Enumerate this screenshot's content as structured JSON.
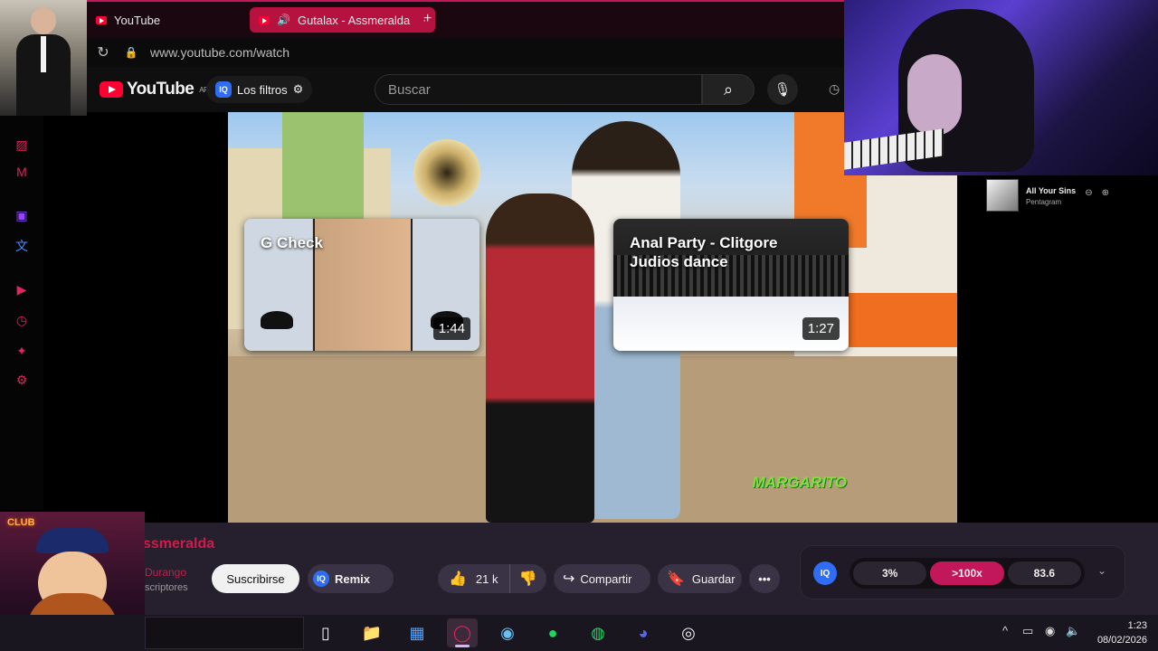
{
  "browser": {
    "tabs": [
      {
        "label": "YouTube",
        "active": false
      },
      {
        "label": "Gutalax - Assmeralda",
        "active": true
      }
    ],
    "new_tab_label": "+",
    "url": "www.youtube.com/watch"
  },
  "youtube": {
    "logo_text": "YouTube",
    "region": "AR",
    "filters_label": "Los filtros",
    "iq_badge": "IQ",
    "search_placeholder": "Buscar"
  },
  "video": {
    "watermark": "MARGARITO",
    "end_cards": [
      {
        "title": "G Check",
        "duration": "1:44"
      },
      {
        "title": "Anal Party - Clitgore Judios dance",
        "duration": "1:27"
      }
    ]
  },
  "channel": {
    "name": "ssmeralda",
    "handle": "Durango",
    "subs": "scriptores"
  },
  "actions": {
    "subscribe": "Suscribirse",
    "remix": "Remix",
    "likes": "21 k",
    "share": "Compartir",
    "save": "Guardar",
    "more": "•••"
  },
  "iq_panel": {
    "logo": "IQ",
    "stats": [
      "3%",
      ">100x",
      "83.6"
    ],
    "chevron": "⌄"
  },
  "now_playing": {
    "song": "All Your Sins",
    "artist": "Pentagram"
  },
  "overlay": {
    "sign": "CLUB"
  },
  "taskbar": {
    "time": "1:23",
    "date": "08/02/2026"
  },
  "colors": {
    "accent": "#c2185b",
    "youtube_red": "#ff0033",
    "taskbar": "#1a1620"
  }
}
